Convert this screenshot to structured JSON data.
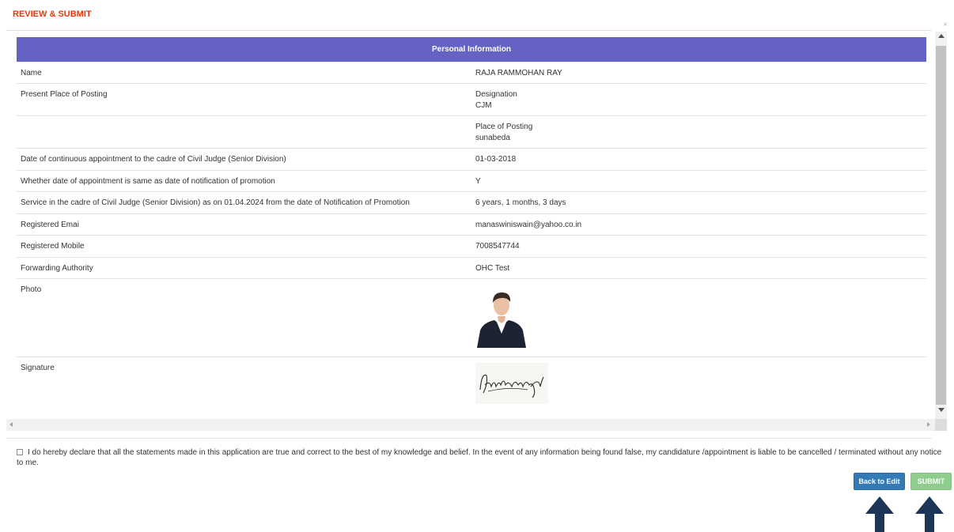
{
  "header": {
    "title": "REVIEW & SUBMIT",
    "close_glyph": "×"
  },
  "table": {
    "heading": "Personal Information",
    "rows": [
      {
        "label": "Name",
        "values": [
          "RAJA RAMMOHAN RAY"
        ]
      },
      {
        "label": "Present Place of Posting",
        "values": [
          "Designation",
          "CJM"
        ]
      },
      {
        "label": "",
        "values": [
          "Place of Posting",
          "sunabeda"
        ]
      },
      {
        "label": "Date of continuous appointment to the cadre of Civil Judge (Senior Division)",
        "values": [
          "01-03-2018"
        ]
      },
      {
        "label": "Whether date of appointment is same as date of notification of promotion",
        "values": [
          "Y"
        ]
      },
      {
        "label": "Service in the cadre of Civil Judge (Senior Division) as on 01.04.2024 from the date of Notification of Promotion",
        "values": [
          "6 years, 1 months, 3 days"
        ]
      },
      {
        "label": "Registered Emai",
        "values": [
          "manaswiniswain@yahoo.co.in"
        ]
      },
      {
        "label": "Registered Mobile",
        "values": [
          "7008547744"
        ]
      },
      {
        "label": "Forwarding Authority",
        "values": [
          "OHC Test"
        ]
      },
      {
        "label": "Photo",
        "values": []
      },
      {
        "label": "Signature",
        "values": []
      }
    ]
  },
  "declaration": {
    "text": "I do hereby declare that all the statements made in this application are true and correct to the best of my knowledge and belief. In the event of any information being found false, my candidature /appointment is liable to be cancelled / terminated without any notice to me.",
    "checked": false
  },
  "buttons": {
    "back_label": "Back to Edit",
    "submit_label": "SUBMIT"
  },
  "colors": {
    "header_accent": "#e8370e",
    "table_header": "#6463c3",
    "back_button": "#337ab7",
    "submit_button": "#8fcd8f",
    "annotation_arrow": "#1d3557"
  },
  "icons": {
    "close": "close-icon",
    "annotation": "arrow-up-icon"
  }
}
